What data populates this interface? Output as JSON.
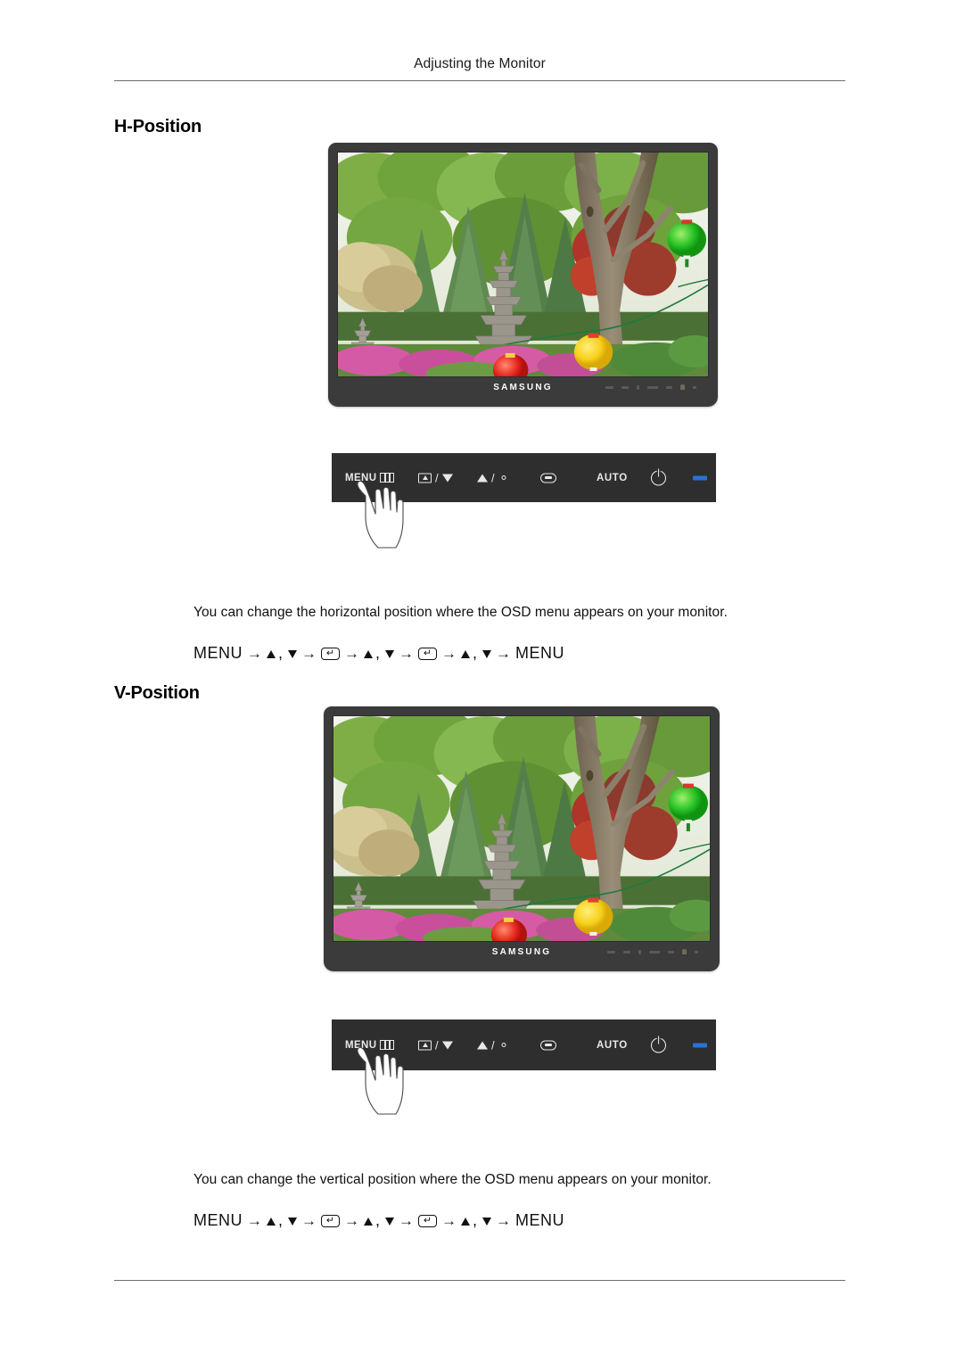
{
  "page": {
    "running_header": "Adjusting the Monitor"
  },
  "sections": [
    {
      "heading": "H-Position",
      "description": "You can change the horizontal position where the OSD menu appears on your monitor.",
      "nav_sequence": {
        "start_label": "MENU",
        "end_label": "MENU",
        "steps": [
          "MENU",
          "up-down",
          "enter",
          "up-down",
          "enter",
          "up-down",
          "MENU"
        ],
        "text": "MENU → ▲ , ▼ → ↵ → ▲ , ▼ → ↵ → ▲ , ▼ → MENU"
      },
      "monitor": {
        "brand": "SAMSUNG",
        "screen_content": "garden-photo-with-stone-pagodas-and-lanterns"
      }
    },
    {
      "heading": "V-Position",
      "description": "You can change the vertical position where the OSD menu appears on your monitor.",
      "nav_sequence": {
        "start_label": "MENU",
        "end_label": "MENU",
        "steps": [
          "MENU",
          "up-down",
          "enter",
          "up-down",
          "enter",
          "up-down",
          "MENU"
        ],
        "text": "MENU → ▲ , ▼ → ↵ → ▲ , ▼ → ↵ → ▲ , ▼ → MENU"
      },
      "monitor": {
        "brand": "SAMSUNG",
        "screen_content": "garden-photo-with-stone-pagodas-and-lanterns"
      }
    }
  ],
  "control_panel": {
    "buttons": [
      {
        "id": "menu",
        "label": "MENU",
        "icon": "menu-bars-icon"
      },
      {
        "id": "source-down",
        "label": "",
        "icon": "source-icon",
        "secondary_icon": "triangle-down-icon",
        "separator": "/"
      },
      {
        "id": "up-brightness",
        "label": "",
        "icon": "triangle-up-icon",
        "secondary_icon": "brightness-sun-icon",
        "separator": "/"
      },
      {
        "id": "enter",
        "label": "",
        "icon": "enter-icon"
      },
      {
        "id": "auto",
        "label": "AUTO",
        "icon": ""
      },
      {
        "id": "power",
        "label": "",
        "icon": "power-icon"
      },
      {
        "id": "power-led",
        "label": "",
        "icon": "led-indicator"
      }
    ],
    "led_color": "#2a72d8",
    "bar_color": "#2e2e2e",
    "pressed_button": "menu",
    "pointer": "hand-pressing-menu"
  },
  "colors": {
    "bezel": "#3b3b3b",
    "control_bar": "#2e2e2e",
    "rule": "#6d6d6d",
    "led_blue": "#2a72d8",
    "text": "#111111"
  }
}
